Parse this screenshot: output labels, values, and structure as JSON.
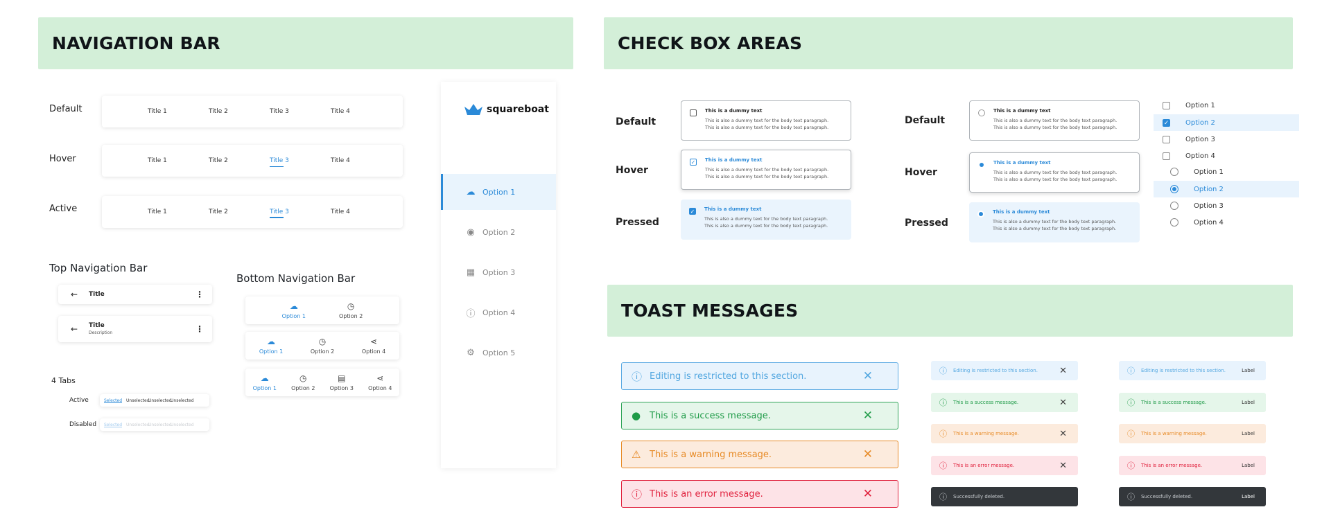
{
  "banners": {
    "nav": "NAVIGATION BAR",
    "checkbox": "CHECK BOX AREAS",
    "toast": "TOAST MESSAGES"
  },
  "nav_states": {
    "default": "Default",
    "hover": "Hover",
    "active": "Active",
    "titles": [
      "Title 1",
      "Title 2",
      "Title 3",
      "Title 4"
    ]
  },
  "top_nav": {
    "heading": "Top Navigation Bar",
    "title": "Title",
    "description": "Description"
  },
  "bottom_nav": {
    "heading": "Bottom Navigation Bar",
    "options": [
      "Option 1",
      "Option 2",
      "Option 3",
      "Option 4"
    ]
  },
  "tabs": {
    "heading": "4 Tabs",
    "active_label": "Active",
    "disabled_label": "Disabled",
    "selected": "Selected",
    "unselected": "Unselected"
  },
  "sidebar": {
    "logo": "squareboat",
    "items": [
      "Option 1",
      "Option 2",
      "Option 3",
      "Option 4",
      "Option 5"
    ]
  },
  "checkbox": {
    "default": "Default",
    "hover": "Hover",
    "pressed": "Pressed",
    "title": "This is a dummy text",
    "body": "This is also a dummy text for the body text paragraph."
  },
  "option_list": {
    "checkboxes": [
      "Option 1",
      "Option 2",
      "Option 3",
      "Option 4"
    ],
    "radios": [
      "Option 1",
      "Option 2",
      "Option 3",
      "Option 4"
    ]
  },
  "toasts": {
    "info": "Editing is restricted to this section.",
    "success": "This is a success message.",
    "warning": "This is a warning message.",
    "error": "This is an error message.",
    "deleted": "Successfully deleted.",
    "label": "Label"
  },
  "colors": {
    "banner": "#d3efd8",
    "accent": "#2b8ad8",
    "success": "#1f9b48",
    "warning": "#e78a25",
    "error": "#e0203c",
    "dark": "#33373b"
  }
}
